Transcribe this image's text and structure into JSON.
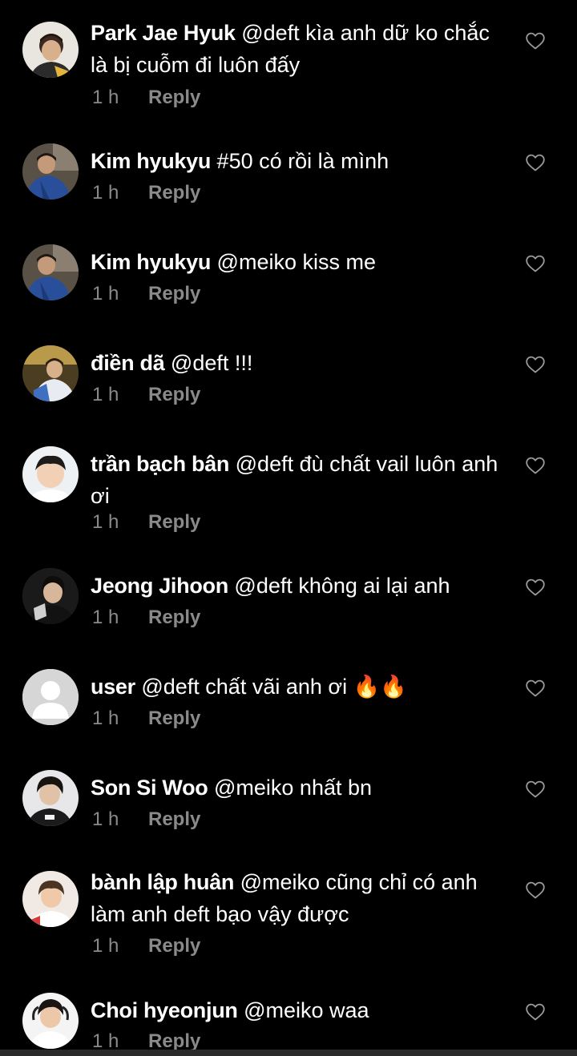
{
  "colors": {
    "background": "#000000",
    "text": "#ffffff",
    "meta": "#8a8a8a",
    "like_outline": "#9a9a9a",
    "default_avatar": "#d6d6d6"
  },
  "comments": [
    {
      "username": "Park Jae Hyuk",
      "text": " @deft kìa anh dữ ko chắc là bị cuỗm đi luôn đấy",
      "time": "1 h",
      "reply_label": "Reply",
      "avatar": "photo-avatar",
      "like_icon": "heart-outline-icon"
    },
    {
      "username": "Kim hyukyu",
      "text": " #50 có rồi là mình",
      "time": "1 h",
      "reply_label": "Reply",
      "avatar": "photo-avatar",
      "like_icon": "heart-outline-icon"
    },
    {
      "username": "Kim hyukyu",
      "text": " @meiko kiss me",
      "time": "1 h",
      "reply_label": "Reply",
      "avatar": "photo-avatar",
      "like_icon": "heart-outline-icon"
    },
    {
      "username": "điền dã",
      "text": " @deft !!!",
      "time": "1 h",
      "reply_label": "Reply",
      "avatar": "photo-avatar",
      "like_icon": "heart-outline-icon"
    },
    {
      "username": "trần bạch bân",
      "text": " @deft đù chất vail luôn anh ơi",
      "time": "1 h",
      "reply_label": "Reply",
      "avatar": "photo-avatar",
      "like_icon": "heart-outline-icon"
    },
    {
      "username": "Jeong Jihoon",
      "text": " @deft không ai lại anh",
      "time": "1 h",
      "reply_label": "Reply",
      "avatar": "photo-avatar",
      "like_icon": "heart-outline-icon"
    },
    {
      "username": "user",
      "text": " @deft chất vãi anh ơi 🔥🔥",
      "time": "1 h",
      "reply_label": "Reply",
      "avatar": "default-avatar",
      "like_icon": "heart-outline-icon"
    },
    {
      "username": "Son Si Woo",
      "text": " @meiko nhất bn",
      "time": "1 h",
      "reply_label": "Reply",
      "avatar": "photo-avatar",
      "like_icon": "heart-outline-icon"
    },
    {
      "username": "bành lập huân",
      "text": " @meiko cũng chỉ có anh làm anh deft bạo vậy được",
      "time": "1 h",
      "reply_label": "Reply",
      "avatar": "photo-avatar",
      "like_icon": "heart-outline-icon"
    },
    {
      "username": "Choi hyeonjun",
      "text": " @meiko waa",
      "time": "1 h",
      "reply_label": "Reply",
      "avatar": "photo-avatar",
      "like_icon": "heart-outline-icon"
    }
  ]
}
